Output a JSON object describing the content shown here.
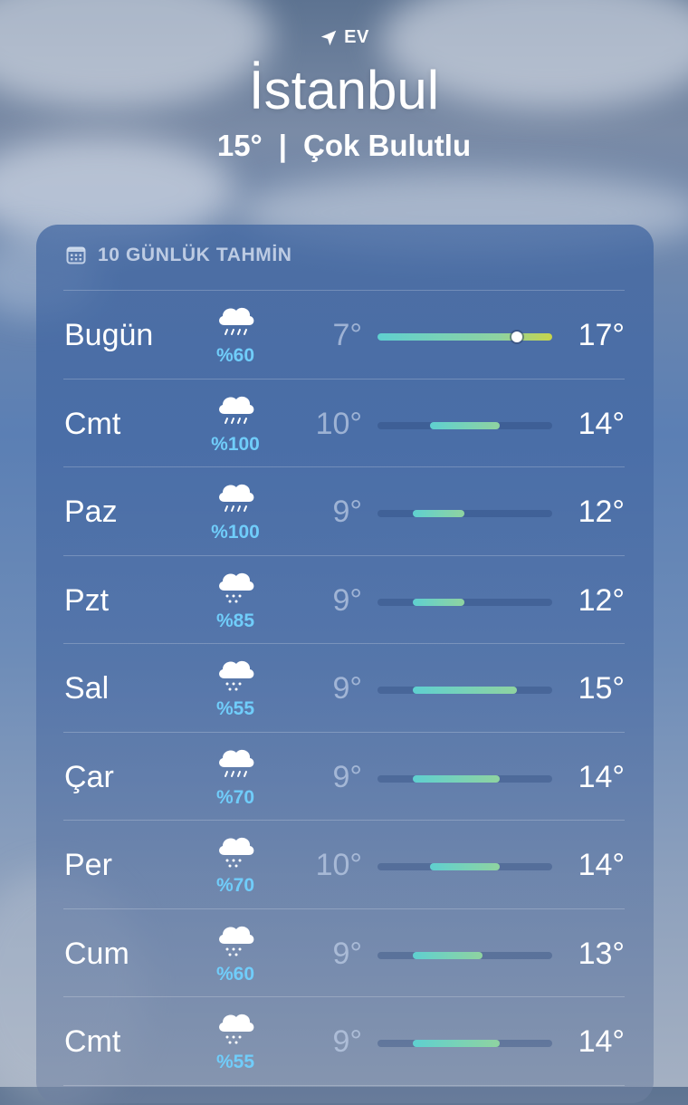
{
  "header": {
    "location_label": "EV",
    "city": "İstanbul",
    "current_temp": "15°",
    "separator": "|",
    "condition": "Çok Bulutlu"
  },
  "forecast": {
    "title": "10 GÜNLÜK TAHMİN",
    "range_min": 7,
    "range_max": 17,
    "current_temp_value": 15,
    "days": [
      {
        "day": "Bugün",
        "icon": "cloud-rain-icon",
        "precip": "%60",
        "low": "7°",
        "high": "17°",
        "low_value": 7,
        "high_value": 17
      },
      {
        "day": "Cmt",
        "icon": "cloud-rain-icon",
        "precip": "%100",
        "low": "10°",
        "high": "14°",
        "low_value": 10,
        "high_value": 14
      },
      {
        "day": "Paz",
        "icon": "cloud-rain-icon",
        "precip": "%100",
        "low": "9°",
        "high": "12°",
        "low_value": 9,
        "high_value": 12
      },
      {
        "day": "Pzt",
        "icon": "cloud-drizzle-icon",
        "precip": "%85",
        "low": "9°",
        "high": "12°",
        "low_value": 9,
        "high_value": 12
      },
      {
        "day": "Sal",
        "icon": "cloud-drizzle-icon",
        "precip": "%55",
        "low": "9°",
        "high": "15°",
        "low_value": 9,
        "high_value": 15
      },
      {
        "day": "Çar",
        "icon": "cloud-rain-icon",
        "precip": "%70",
        "low": "9°",
        "high": "14°",
        "low_value": 9,
        "high_value": 14
      },
      {
        "day": "Per",
        "icon": "cloud-drizzle-icon",
        "precip": "%70",
        "low": "10°",
        "high": "14°",
        "low_value": 10,
        "high_value": 14
      },
      {
        "day": "Cum",
        "icon": "cloud-drizzle-icon",
        "precip": "%60",
        "low": "9°",
        "high": "13°",
        "low_value": 9,
        "high_value": 13
      },
      {
        "day": "Cmt",
        "icon": "cloud-drizzle-icon",
        "precip": "%55",
        "low": "9°",
        "high": "14°",
        "low_value": 9,
        "high_value": 14
      }
    ]
  },
  "colors": {
    "precip": "#70cdfa",
    "bar_cool": "#5fd0d0",
    "bar_mid": "#8fd3a0",
    "bar_warm": "#c8d44a"
  }
}
